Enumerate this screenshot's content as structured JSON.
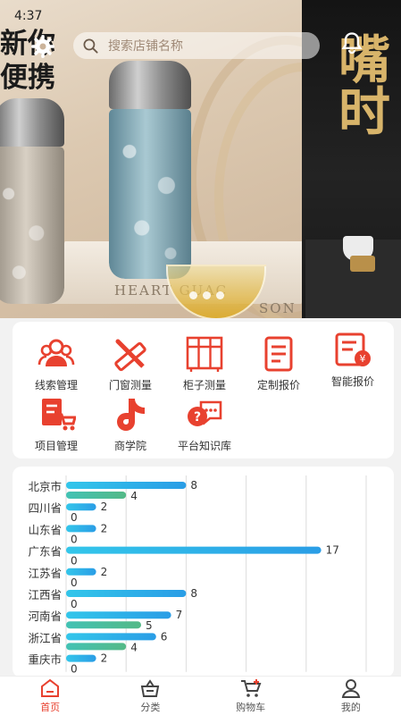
{
  "status_bar": {
    "time": "4:37"
  },
  "banner": {
    "promo_line1": "新你",
    "promo_line2": "便携",
    "product_text_1": "HEART GUAC",
    "product_text_2": "SON",
    "gold_text": "嘴时",
    "pager_dots": 3
  },
  "search": {
    "placeholder": "搜索店铺名称"
  },
  "colors": {
    "accent": "#e8412f",
    "bar_blue": "#2a9de6",
    "bar_green": "#54b987"
  },
  "menu": {
    "items": [
      {
        "label": "线索管理",
        "icon": "users-icon"
      },
      {
        "label": "门窗测量",
        "icon": "ruler-pencil-icon"
      },
      {
        "label": "柜子测量",
        "icon": "cabinet-icon"
      },
      {
        "label": "定制报价",
        "icon": "document-icon"
      },
      {
        "label": "智能报价",
        "icon": "yen-document-icon"
      },
      {
        "label": "项目管理",
        "icon": "project-cart-icon"
      },
      {
        "label": "商学院",
        "icon": "music-note-icon"
      },
      {
        "label": "平台知识库",
        "icon": "chat-question-icon"
      }
    ]
  },
  "chart_data": {
    "type": "bar",
    "orientation": "horizontal",
    "categories": [
      "北京市",
      "四川省",
      "山东省",
      "广东省",
      "江苏省",
      "江西省",
      "河南省",
      "浙江省",
      "重庆市"
    ],
    "series": [
      {
        "values": [
          8,
          2,
          2,
          17,
          2,
          8,
          7,
          6,
          2
        ]
      },
      {
        "values": [
          4,
          0,
          0,
          0,
          0,
          0,
          5,
          4,
          0
        ]
      }
    ],
    "xlim": [
      0,
      20
    ],
    "grid": true
  },
  "tabbar": {
    "tabs": [
      {
        "label": "首页",
        "icon": "home-icon",
        "active": true
      },
      {
        "label": "分类",
        "icon": "basket-icon",
        "active": false
      },
      {
        "label": "购物车",
        "icon": "cart-icon",
        "active": false
      },
      {
        "label": "我的",
        "icon": "user-icon",
        "active": false
      }
    ]
  }
}
